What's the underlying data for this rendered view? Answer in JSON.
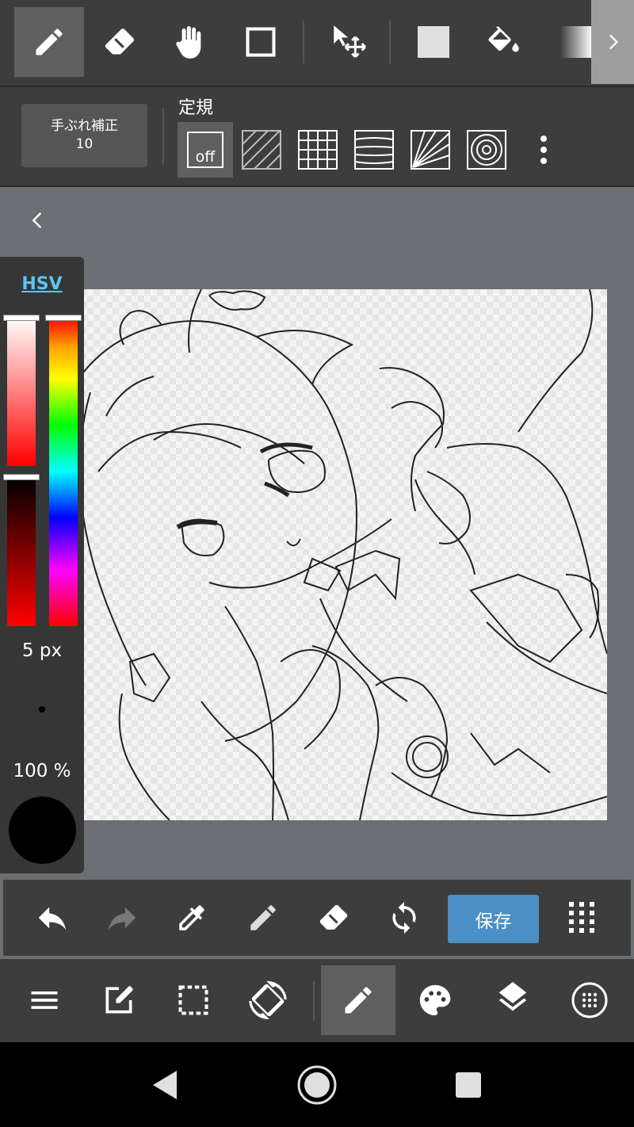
{
  "top_toolbar": {
    "tools": [
      {
        "id": "pen",
        "icon": "pen-icon",
        "active": true
      },
      {
        "id": "eraser",
        "icon": "eraser-icon"
      },
      {
        "id": "hand",
        "icon": "hand-icon"
      },
      {
        "id": "shape",
        "icon": "square-outline-icon"
      },
      {
        "id": "move",
        "icon": "move-select-icon"
      },
      {
        "id": "fill-color",
        "icon": "filled-square-icon"
      },
      {
        "id": "bucket",
        "icon": "paint-bucket-icon"
      },
      {
        "id": "gradient",
        "icon": "gradient-icon"
      }
    ],
    "more_icon": "chevron-right-icon"
  },
  "ruler_bar": {
    "stabilizer_label": "手ぶれ補正",
    "stabilizer_value": "10",
    "ruler_title": "定規",
    "off_label": "off",
    "options": [
      "off",
      "parallel",
      "grid",
      "perspective-lines",
      "radial",
      "concentric"
    ],
    "more_icon": "more-vertical-icon"
  },
  "color_panel": {
    "mode_label": "HSV",
    "brush_size": "5 px",
    "opacity": "100 %",
    "current_color": "#000000"
  },
  "action_bar": {
    "buttons": [
      "undo",
      "redo",
      "eyedropper",
      "pen",
      "eraser",
      "rotate"
    ],
    "save_label": "保存",
    "grid_icon": "dot-grid-icon"
  },
  "bottom_nav": {
    "items": [
      "menu",
      "edit",
      "selection",
      "rotate-screen",
      "brush",
      "palette",
      "layers",
      "material"
    ],
    "active": "brush"
  },
  "colors": {
    "toolbar_bg": "#3d3d3d",
    "active_bg": "#5f5f5f",
    "accent": "#4a8fc6",
    "hsv_link": "#5cc4f5"
  }
}
